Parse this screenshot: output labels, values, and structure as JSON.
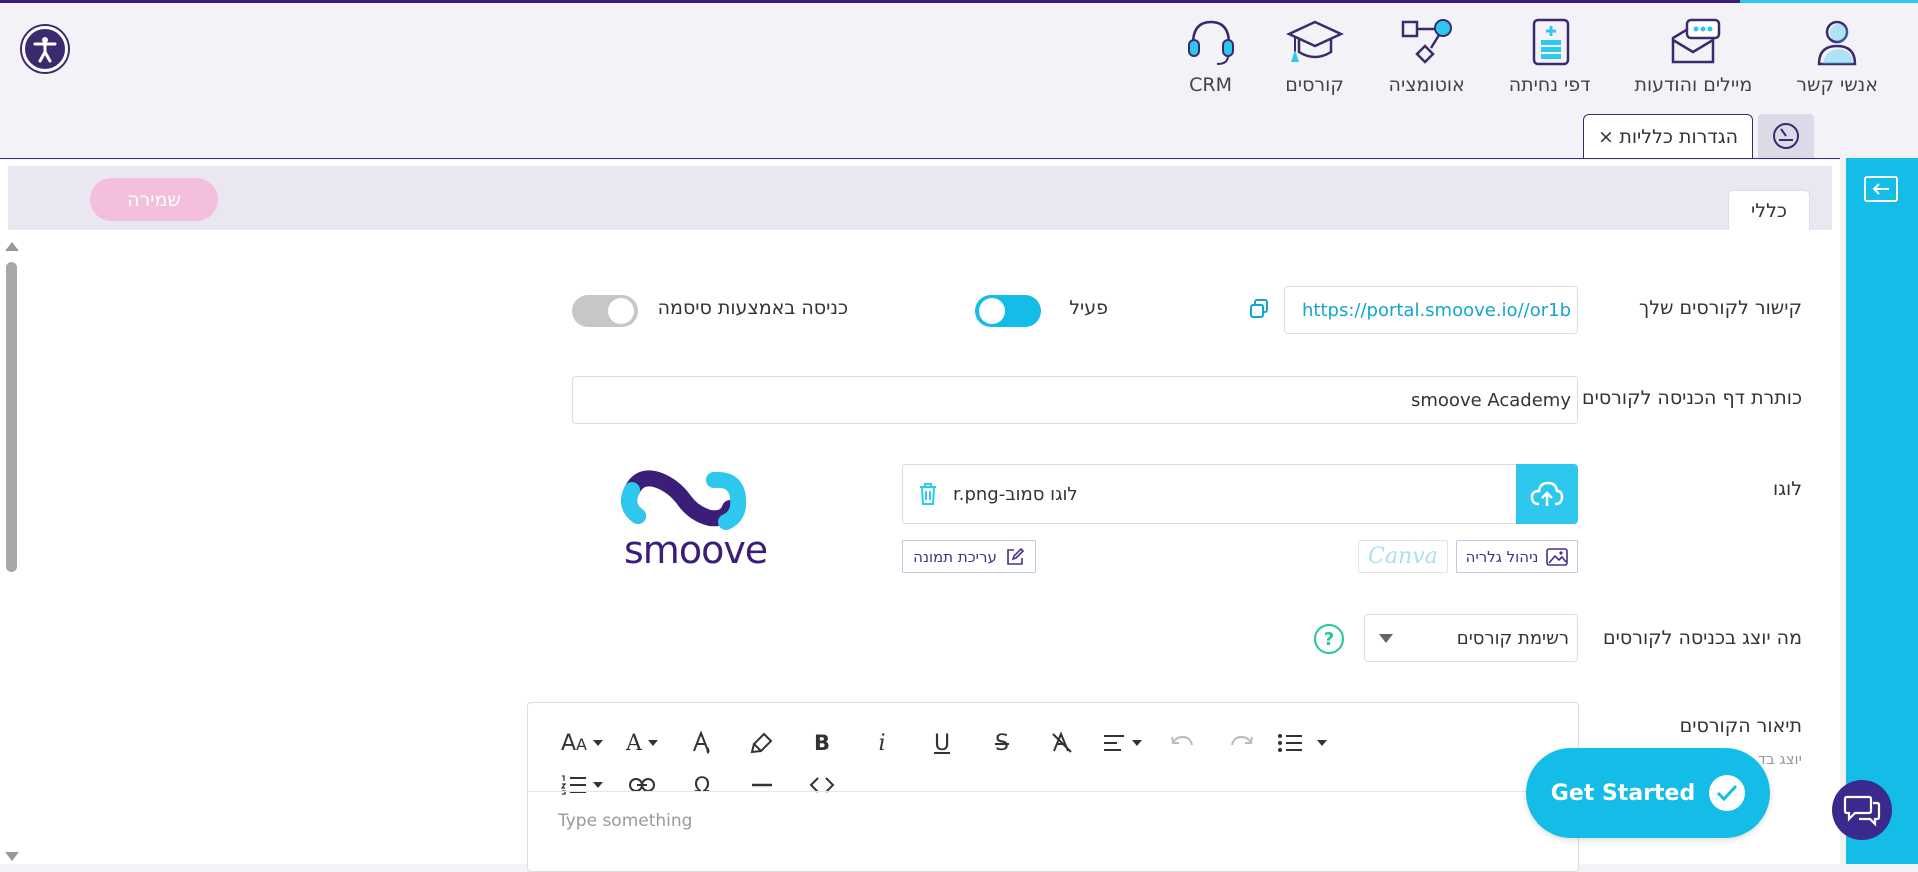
{
  "nav": {
    "items": [
      {
        "label": "אנשי קשר",
        "icon": "contacts-icon"
      },
      {
        "label": "מיילים והודעות",
        "icon": "emails-icon"
      },
      {
        "label": "דפי נחיתה",
        "icon": "landing-pages-icon"
      },
      {
        "label": "אוטומציה",
        "icon": "automation-icon"
      },
      {
        "label": "קורסים",
        "icon": "courses-icon"
      },
      {
        "label": "CRM",
        "icon": "crm-icon"
      }
    ]
  },
  "tabs": {
    "active_label": "הגדרות כלליות",
    "close_glyph": "×"
  },
  "subheader": {
    "tab_label": "כללי",
    "save_label": "שמירה"
  },
  "form": {
    "course_link": {
      "label": "קישור לקורסים שלך",
      "value": "https://portal.smoove.io//or1b"
    },
    "active_toggle": {
      "label": "פעיל",
      "on": true
    },
    "password_toggle": {
      "label": "כניסה באמצעות סיסמה",
      "on": false
    },
    "page_title": {
      "label": "כותרת דף הכניסה לקורסים",
      "value": "smoove Academy"
    },
    "logo": {
      "label": "לוגו",
      "file_name": "לוגו סמוב-r.png",
      "gallery_label": "ניהול גלריה",
      "canva_label": "Canva",
      "edit_label": "עריכת תמונה",
      "preview_text": "smoove"
    },
    "display": {
      "label": "מה יוצג בכניסה לקורסים",
      "value": "רשימת קורסים"
    },
    "description": {
      "label": "תיאור הקורסים",
      "sublabel": "יוצג בד",
      "placeholder": "Type something"
    }
  },
  "get_started": {
    "label": "Get Started"
  },
  "colors": {
    "brand_purple": "#3b2a6e",
    "accent_cyan": "#13bde8",
    "save_pink": "#f4bfdc"
  }
}
